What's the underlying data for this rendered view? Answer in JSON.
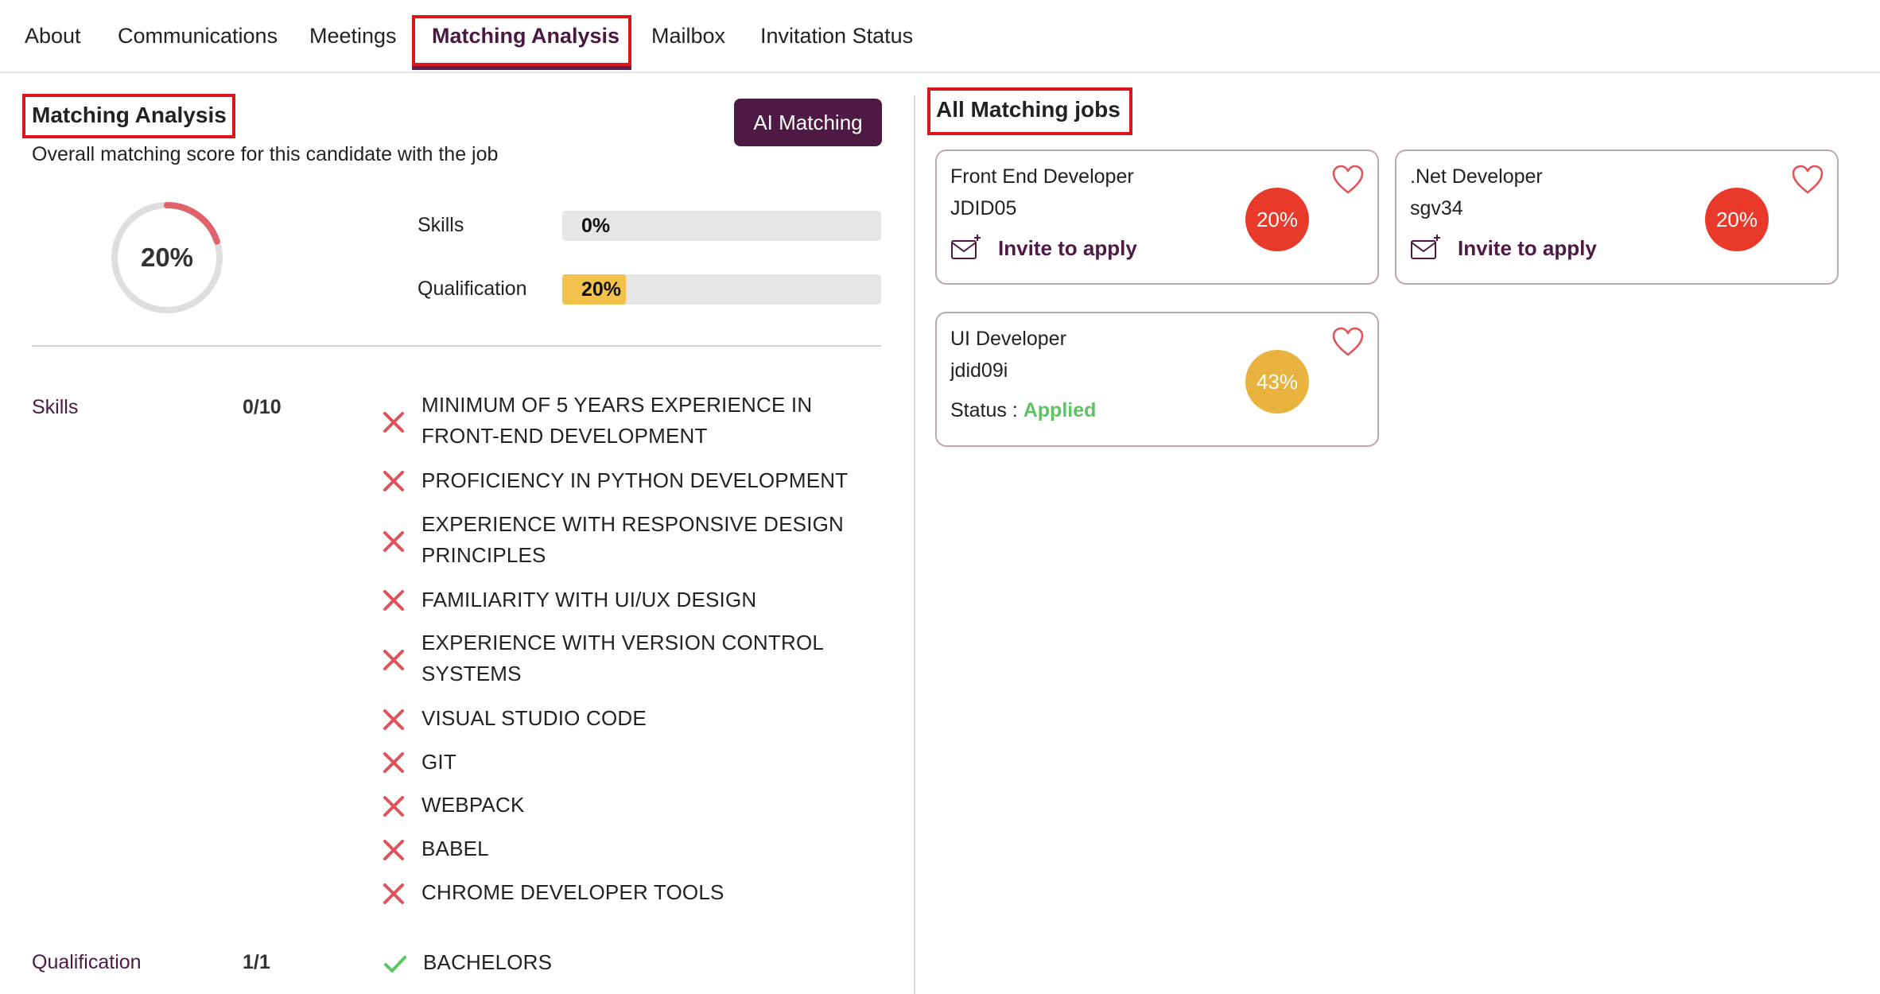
{
  "tabs": [
    {
      "label": "About",
      "active": false
    },
    {
      "label": "Communications",
      "active": false
    },
    {
      "label": "Meetings",
      "active": false
    },
    {
      "label": "Matching Analysis",
      "active": true
    },
    {
      "label": "Mailbox",
      "active": false
    },
    {
      "label": "Invitation Status",
      "active": false
    }
  ],
  "analysis": {
    "title": "Matching Analysis",
    "subtitle": "Overall matching score for this candidate with the job",
    "ai_button": "AI Matching",
    "overall_score": "20%",
    "overall_fraction": 0.2,
    "bars": [
      {
        "label": "Skills",
        "value_text": "0%",
        "value": 0
      },
      {
        "label": "Qualification",
        "value_text": "20%",
        "value": 0.2
      }
    ],
    "skills_section": {
      "label": "Skills",
      "score": "0/10",
      "items": [
        {
          "text": "MINIMUM OF 5 YEARS EXPERIENCE IN FRONT-END DEVELOPMENT",
          "matched": false
        },
        {
          "text": "PROFICIENCY IN PYTHON DEVELOPMENT",
          "matched": false
        },
        {
          "text": "EXPERIENCE WITH RESPONSIVE DESIGN PRINCIPLES",
          "matched": false
        },
        {
          "text": "FAMILIARITY WITH UI/UX DESIGN",
          "matched": false
        },
        {
          "text": "EXPERIENCE WITH VERSION CONTROL SYSTEMS",
          "matched": false
        },
        {
          "text": "VISUAL STUDIO CODE",
          "matched": false
        },
        {
          "text": "GIT",
          "matched": false
        },
        {
          "text": "WEBPACK",
          "matched": false
        },
        {
          "text": "BABEL",
          "matched": false
        },
        {
          "text": "CHROME DEVELOPER TOOLS",
          "matched": false
        }
      ]
    },
    "qualification_section": {
      "label": "Qualification",
      "score": "1/1",
      "items": [
        {
          "text": "BACHELORS",
          "matched": true
        }
      ]
    }
  },
  "jobs": {
    "title": "All Matching jobs",
    "cards": [
      {
        "title": "Front End Developer",
        "id": "JDID05",
        "score": "20%",
        "score_color": "#e8392a",
        "action": "Invite to apply"
      },
      {
        "title": ".Net Developer",
        "id": "sgv34",
        "score": "20%",
        "score_color": "#e8392a",
        "action": "Invite to apply"
      },
      {
        "title": "UI Developer",
        "id": "jdid09i",
        "score": "43%",
        "score_color": "#e8b33f",
        "status_label": "Status : ",
        "status_value": "Applied"
      }
    ]
  },
  "colors": {
    "brand": "#4e1a44",
    "danger": "#e8392a",
    "warning": "#e8b33f",
    "success": "#5cc463",
    "highlight_box": "#e0141c"
  },
  "icons": {
    "cross": "close-icon",
    "check": "check-icon",
    "heart": "heart-icon",
    "mail": "mail-plus-icon"
  }
}
